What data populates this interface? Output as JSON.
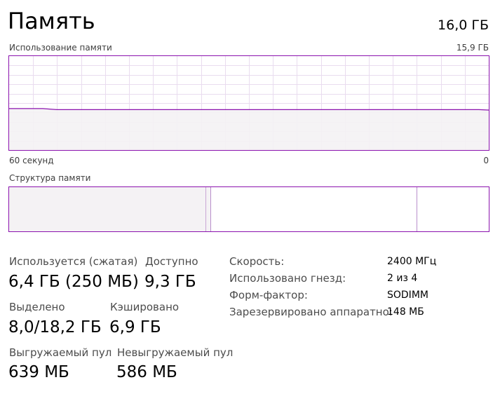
{
  "header": {
    "title": "Память",
    "total": "16,0 ГБ"
  },
  "usage_graph": {
    "label": "Использование памяти",
    "max_label": "15,9 ГБ",
    "time_left": "60 секунд",
    "time_right": "0",
    "line_color": "#8b12ae",
    "fill_color": "#f4f2f4",
    "grid_color": "#e9dcef",
    "used_fraction": 0.43
  },
  "composition": {
    "label": "Структура памяти",
    "in_use_fraction": 0.41,
    "modified_fraction": 0.01,
    "standby_fraction": 0.43,
    "free_fraction": 0.15
  },
  "stats": {
    "in_use_label": "Используется (сжатая)",
    "in_use_value": "6,4 ГБ (250 МБ)",
    "available_label": "Доступно",
    "available_value": "9,3 ГБ",
    "committed_label": "Выделено",
    "committed_value": "8,0/18,2 ГБ",
    "cached_label": "Кэшировано",
    "cached_value": "6,9 ГБ",
    "paged_label": "Выгружаемый пул",
    "paged_value": "639 МБ",
    "nonpaged_label": "Невыгружаемый пул",
    "nonpaged_value": "586 МБ"
  },
  "properties": [
    {
      "label": "Скорость:",
      "value": "2400 МГц"
    },
    {
      "label": "Использовано гнезд:",
      "value": "2 из 4"
    },
    {
      "label": "Форм-фактор:",
      "value": "SODIMM"
    },
    {
      "label": "Зарезервировано аппаратно:",
      "value": "148 МБ"
    }
  ]
}
